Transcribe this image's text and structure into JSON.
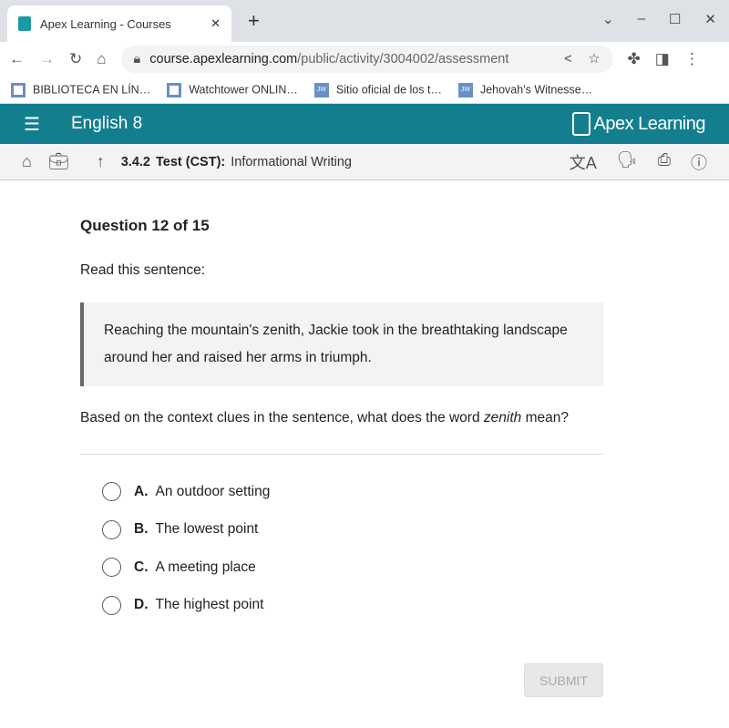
{
  "browser": {
    "tab_title": "Apex Learning - Courses",
    "url_host": "course.apexlearning.com",
    "url_path": "/public/activity/3004002/assessment",
    "bookmarks": [
      {
        "label": "BIBLIOTECA EN LÍN…",
        "icon": "book"
      },
      {
        "label": "Watchtower ONLIN…",
        "icon": "book"
      },
      {
        "label": "Sitio oficial de los t…",
        "icon": "JW"
      },
      {
        "label": "Jehovah's Witnesse…",
        "icon": "JW"
      }
    ]
  },
  "header": {
    "course": "English 8",
    "logo": "Apex Learning",
    "color": "#137f8e"
  },
  "subheader": {
    "number": "3.4.2",
    "type": "Test (CST):",
    "name": "Informational Writing"
  },
  "question": {
    "number": "Question 12 of 15",
    "prompt": "Read this sentence:",
    "quote": "Reaching the mountain's zenith, Jackie took in the breathtaking landscape around her and raised her arms in triumph.",
    "text_before": "Based on the context clues in the sentence, what does the word ",
    "word": "zenith",
    "text_after": " mean?",
    "options": [
      {
        "letter": "A.",
        "text": "An outdoor setting"
      },
      {
        "letter": "B.",
        "text": "The lowest point"
      },
      {
        "letter": "C.",
        "text": "A meeting place"
      },
      {
        "letter": "D.",
        "text": "The highest point"
      }
    ]
  },
  "submit_label": "SUBMIT"
}
